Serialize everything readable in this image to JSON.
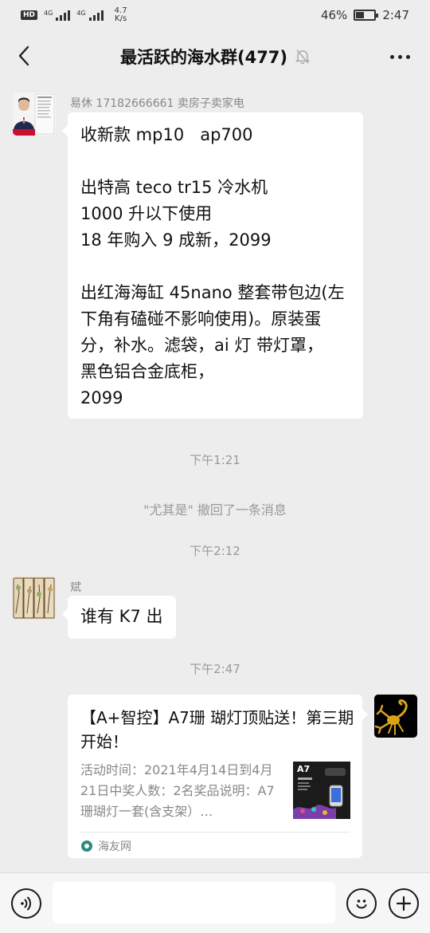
{
  "status_bar": {
    "sim1_label": "4G",
    "sim2_label": "4G",
    "net_speed_value": "4.7",
    "net_speed_unit": "K/s",
    "battery_percent": "46%",
    "battery_level": 0.46,
    "time": "2:47"
  },
  "header": {
    "title": "最活跃的海水群(477)"
  },
  "messages": [
    {
      "sender": "易休  17182666661 卖房子卖家电",
      "lines": [
        "收新款 mp10   ap700",
        "",
        "出特高 teco tr15 冷水机",
        "1000 升以下使用",
        "18 年购入 9 成新，2099",
        "",
        "出红海海缸 45nano 整套带包边(左",
        "下角有磕碰不影响使用)。原装蛋",
        "分，补水。滤袋，ai 灯 带灯罩，",
        "黑色铝合金底柜，",
        "2099"
      ]
    },
    {
      "sender": "斌",
      "text": "谁有 K7 出"
    }
  ],
  "timestamps": [
    "下午1:21",
    "下午2:12",
    "下午2:47"
  ],
  "system_message": "\"尤其是\" 撤回了一条消息",
  "link_card": {
    "title": "【A+智控】A7珊 瑚灯顶贴送！第三期开始！",
    "description": "活动时间：2021年4月14日到4月21日中奖人数：2名奖品说明：A7珊瑚灯一套(含支架）…",
    "thumb_label": "A7",
    "source": "海友网"
  },
  "colors": {
    "chat_background": "#ededed",
    "bubble": "#ffffff",
    "link_source_icon": "#2a8a7e",
    "scorpion": "#d9a21b"
  }
}
